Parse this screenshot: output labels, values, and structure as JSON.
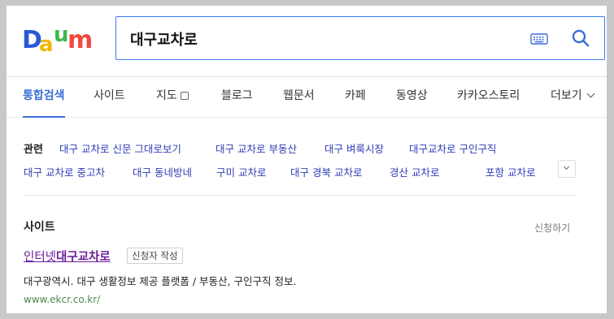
{
  "header": {
    "logo_text": "Daum",
    "search": {
      "value": "대구교차로",
      "placeholder": ""
    },
    "icons": {
      "keyboard": "keyboard-icon",
      "search": "search-icon"
    }
  },
  "tabs": [
    {
      "label": "통합검색",
      "active": true
    },
    {
      "label": "사이트"
    },
    {
      "label": "지도"
    },
    {
      "label": "블로그"
    },
    {
      "label": "웹문서"
    },
    {
      "label": "카페"
    },
    {
      "label": "동영상"
    },
    {
      "label": "카카오스토리"
    },
    {
      "label": "더보기"
    }
  ],
  "related": {
    "label": "관련",
    "links": [
      "대구 교차로 신문 그대로보기",
      "대구 교차로 부동산",
      "대구 벼룩시장",
      "대구교차로 구인구직",
      "대구 교차로 중고차",
      "대구 동네방네",
      "구미 교차로",
      "대구 경북 교차로",
      "경산 교차로",
      "포항 교차로"
    ]
  },
  "site_section": {
    "title": "사이트",
    "apply_label": "신청하기",
    "result": {
      "title_prefix": "인터넷",
      "title_bold": "대구교차로",
      "badge": "신청자 작성",
      "description": "대구광역시. 대구 생활정보 제공 플랫폼 / 부동산, 구인구직 정보.",
      "url": "www.ekcr.co.kr/"
    }
  },
  "colors": {
    "accent": "#3b6ed6",
    "link": "#2f3cb5",
    "visited_title": "#6a1b9a",
    "url": "#4c8a4a",
    "search_border": "#3a7afe"
  }
}
